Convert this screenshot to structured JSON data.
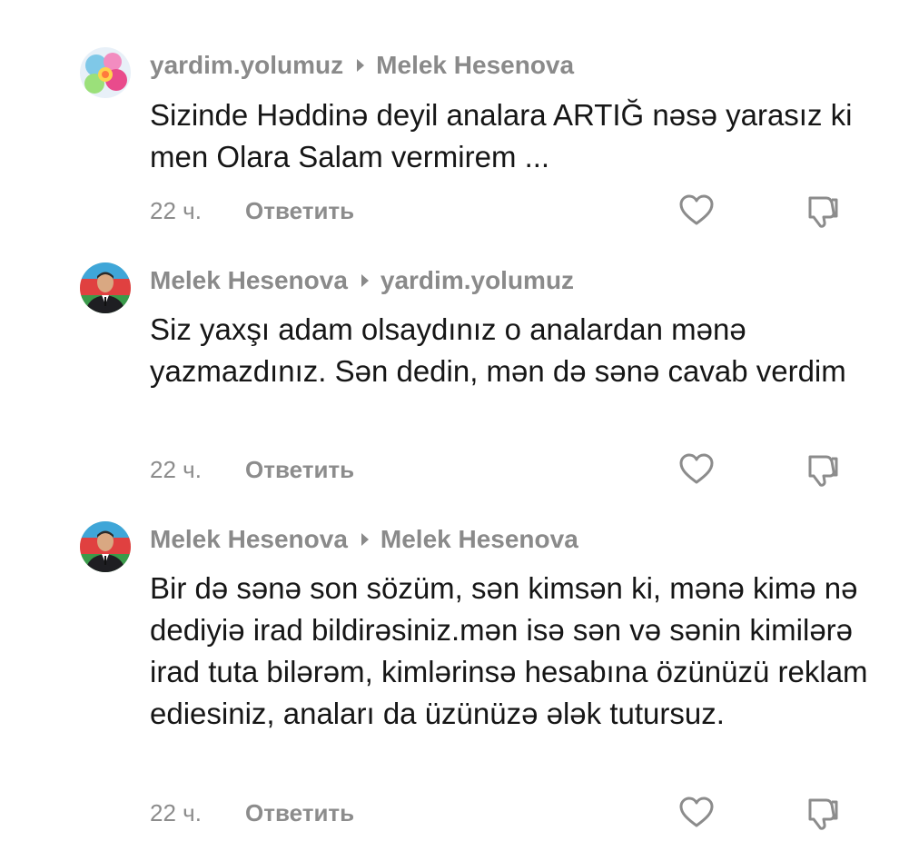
{
  "comments": [
    {
      "author": "yardim.yolumuz",
      "reply_to": "Melek Hesenova",
      "text": "Sizinde Həddinə deyil analara ARTIĞ nəsə yarasız ki men Olara Salam vermirem ...",
      "time": "22 ч.",
      "reply_label": "Ответить",
      "avatar": "flower-avatar"
    },
    {
      "author": "Melek Hesenova",
      "reply_to": "yardim.yolumuz",
      "text": "Siz yaxşı adam olsaydınız o analardan mənə yazmazdınız. Sən dedin, mən də sənə cavab verdim",
      "time": "22 ч.",
      "reply_label": "Ответить",
      "avatar": "uniform-portrait-avatar"
    },
    {
      "author": "Melek Hesenova",
      "reply_to": "Melek Hesenova",
      "text": "Bir də sənə son sözüm, sən kimsən ki, mənə kimə nə dediyiə irad bildirəsiniz.mən isə sən və sənin kimilərə irad tuta bilərəm, kimlərinsə hesabına özünüzü reklam ediesiniz, anaları da üzünüzə ələk tutursuz.",
      "time": "22 ч.",
      "reply_label": "Ответить",
      "avatar": "uniform-portrait-avatar"
    }
  ],
  "colors": {
    "meta_gray": "#8a8a8a",
    "text": "#161616",
    "icon_gray": "#8c8c8c"
  }
}
